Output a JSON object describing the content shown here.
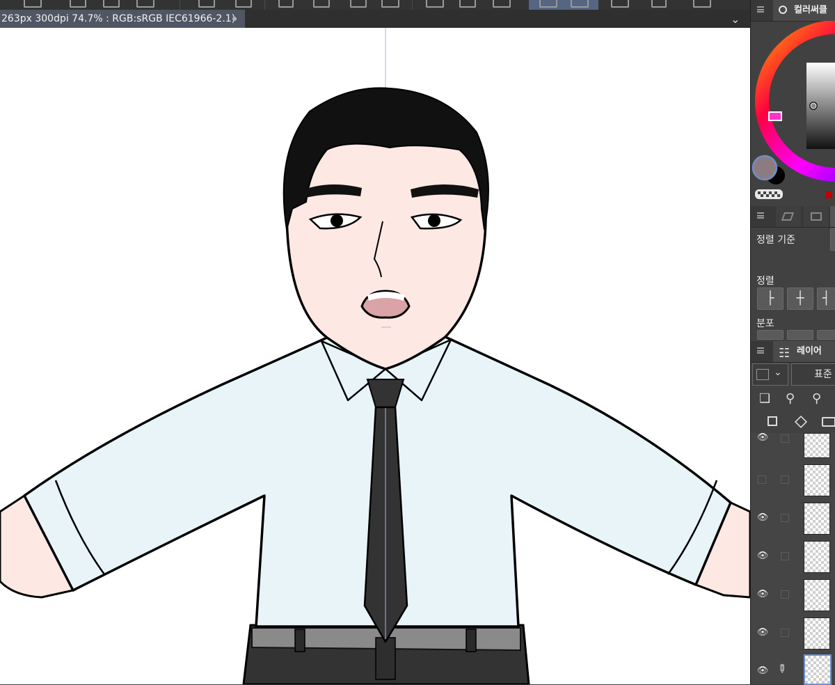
{
  "document_tab": {
    "status": "263px 300dpi 74.7% : RGB:sRGB IEC61966-2.1)"
  },
  "icons": [
    "chevron-down-icon",
    "color-circle-icon",
    "layers-icon",
    "eye-icon",
    "pen-icon",
    "folder-add-icon"
  ],
  "colors": {
    "accent": "#566582",
    "main_color": "#8c7c82",
    "sub_color": "#000000",
    "canvas": "#ffffff",
    "skin": "#fde8e4",
    "shirt": "#e8f4f8",
    "tie": "#333333"
  },
  "color_panel": {
    "title": "컬러써클"
  },
  "align_panel": {
    "basis_label": "정렬 기준",
    "align_label": "정렬",
    "distribute_label": "분포"
  },
  "layer_panel": {
    "title": "레이어",
    "blend_mode": "표준",
    "rows": [
      {
        "visible": true
      },
      {
        "visible": false
      },
      {
        "visible": true
      },
      {
        "visible": true
      },
      {
        "visible": true
      },
      {
        "visible": true
      },
      {
        "visible": true,
        "editing": true
      }
    ]
  }
}
